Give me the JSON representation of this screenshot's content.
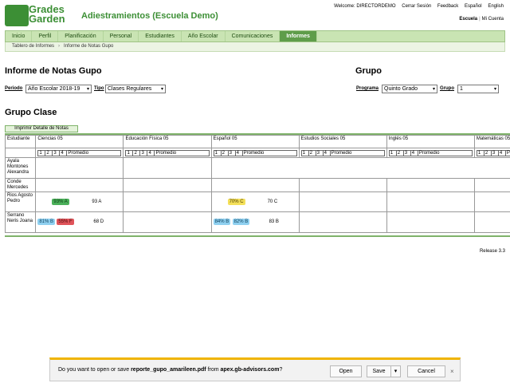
{
  "header": {
    "logo_line1": "Grades",
    "logo_line2": "Garden",
    "title": "Adiestramientos (Escuela Demo)",
    "welcome": "Welcome: DIRECTORDEMO",
    "logout": "Cerrar Sesión",
    "feedback": "Feedback",
    "lang_es": "Español",
    "lang_en": "English",
    "school_link": "Escuela",
    "separator": "|",
    "account_link": "Mi Cuenta"
  },
  "nav": {
    "tabs": [
      "Inicio",
      "Perfil",
      "Planificación",
      "Personal",
      "Estudiantes",
      "Año Escolar",
      "Comunicaciones",
      "Informes"
    ],
    "active": "Informes"
  },
  "breadcrumb": {
    "root": "Tablero de Informes",
    "arrow": "›",
    "current": "Informe de Notas Gupo"
  },
  "report": {
    "title": "Informe de Notas Gupo",
    "period_label": "Periodo",
    "period_value": "Año Escolar 2018-19",
    "type_label": "Tipo",
    "type_value": "Clases Regulares"
  },
  "group": {
    "title": "Grupo",
    "program_label": "Programa",
    "program_value": "Quinto Grado",
    "group_label": "Grupo",
    "group_value": "1"
  },
  "class_group": {
    "title": "Grupo Clase",
    "print_button": "Imprimir Detalle de Notas",
    "student_header": "Estudiante",
    "subjects": [
      "Ciencias 05",
      "Educación Física 05",
      "Español 05",
      "Estudios Sociales 05",
      "Inglés 05",
      "Matemáticas 05"
    ],
    "period_cols": [
      "1",
      "2",
      "3",
      "4",
      "Promedio"
    ],
    "students": [
      "Ayala Montones Alexandra",
      "Conde Mercedes",
      "Rios Agosto Pedro",
      "Serrano Neris Joana"
    ],
    "grades": {
      "rios_ciencias_badge": "93% A",
      "rios_ciencias_avg": "93 A",
      "rios_espanol_badge": "70% C",
      "rios_espanol_avg": "70 C",
      "serrano_ciencias_b1": "81% B",
      "serrano_ciencias_b2": "55% F",
      "serrano_ciencias_avg": "68 D",
      "serrano_espanol_b1": "84% B",
      "serrano_espanol_b2": "82% B",
      "serrano_espanol_avg": "83 B"
    }
  },
  "release": "Release 3.3",
  "download_bar": {
    "prefix": "Do you want to open or save",
    "filename": "reporte_gupo_amarileen.pdf",
    "middle": "from",
    "domain": "apex.gb-advisors.com",
    "suffix": "?",
    "open": "Open",
    "save": "Save",
    "save_drop": "▾",
    "cancel": "Cancel",
    "close": "×"
  },
  "colors": {
    "brand_green": "#3c8f35",
    "nav_bg": "#c9e4b3",
    "badge_green": "#4bb05a",
    "badge_blue": "#8fd0f0",
    "badge_red": "#e0545a",
    "badge_yellow": "#f4e05a"
  }
}
